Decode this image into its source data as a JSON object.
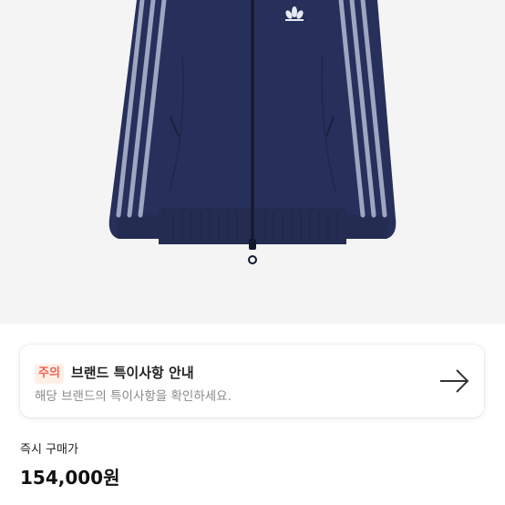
{
  "product": {
    "image_name": "product-jacket-image",
    "colors": {
      "jacket": "#27305a",
      "stripes": "#9ea6c1",
      "background": "#f4f4f4"
    }
  },
  "notice": {
    "badge": "주의",
    "title": "브랜드 특이사항 안내",
    "subtitle": "해당 브랜드의 특이사항을 확인하세요.",
    "icon": "arrow-right-icon",
    "badge_color": "#ef6253"
  },
  "price": {
    "label": "즉시 구매가",
    "value": "154,000원"
  }
}
